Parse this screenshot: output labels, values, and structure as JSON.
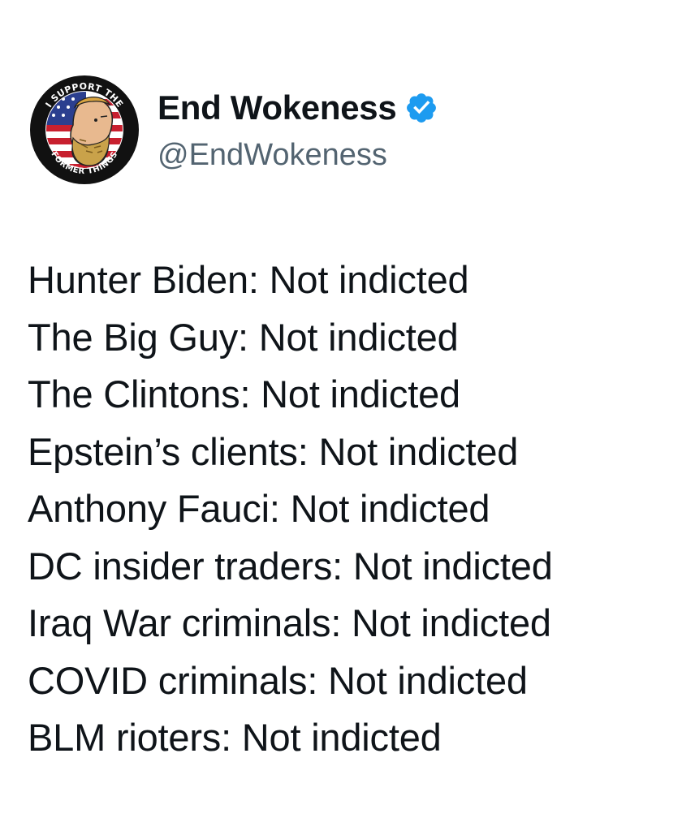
{
  "author": {
    "display_name": "End Wokeness",
    "handle": "@EndWokeness",
    "avatar_icon": "patriot-badge-avatar-icon",
    "avatar_badge_text_top": "I SUPPORT THE",
    "avatar_badge_text_bottom": "FORMER THINGS",
    "verified_icon": "verified-badge-icon",
    "verified_color": "#1d9bf0"
  },
  "tweet": {
    "lines": [
      "Hunter Biden: Not indicted",
      "The Big Guy: Not indicted",
      "The Clintons: Not indicted",
      "Epstein’s clients: Not indicted",
      "Anthony Fauci: Not indicted",
      "DC insider traders: Not indicted",
      "Iraq War criminals: Not indicted",
      "COVID criminals: Not indicted",
      "BLM rioters: Not indicted"
    ]
  },
  "colors": {
    "text": "#0f1419",
    "secondary_text": "#536471",
    "background": "#ffffff"
  }
}
